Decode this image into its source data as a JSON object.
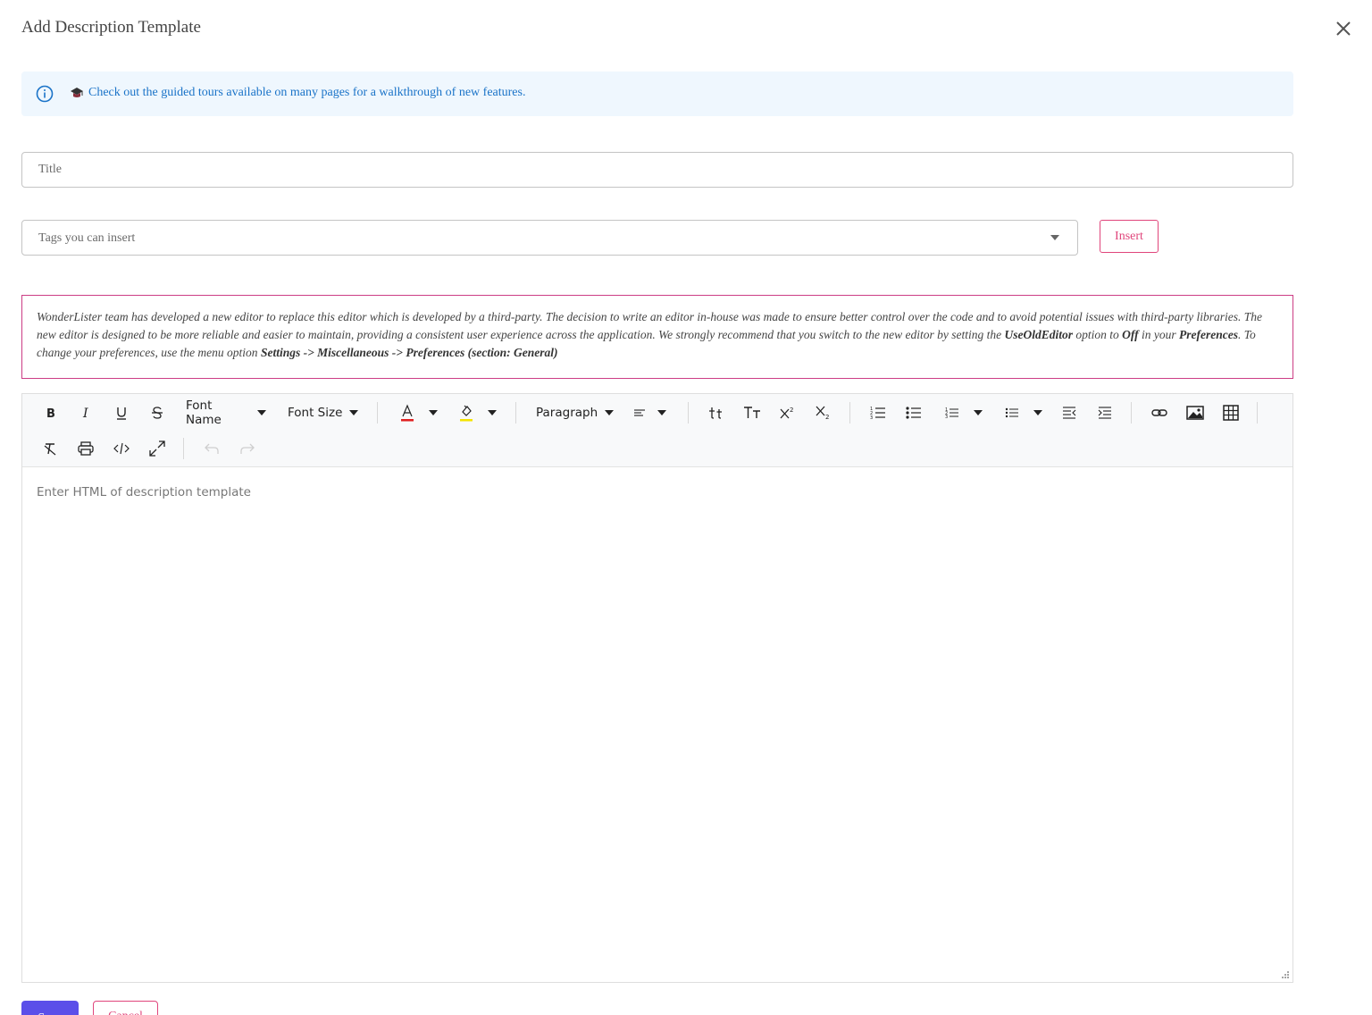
{
  "dialog": {
    "title": "Add Description Template",
    "close_icon": "close-icon"
  },
  "info_banner": {
    "icon": "info-icon",
    "prefix_icon": "graduation-cap-icon",
    "text": "Check out the guided tours available on many pages for a walkthrough of new features."
  },
  "form": {
    "title_placeholder": "Title",
    "title_value": "",
    "tags_placeholder": "Tags you can insert",
    "insert_label": "Insert"
  },
  "notice": {
    "part1": "WonderLister team has developed a new editor to replace this editor which is developed by a third-party. The decision to write an editor in-house was made to ensure better control over the code and to avoid potential issues with third-party libraries. The new editor is designed to be more reliable and easier to maintain, providing a consistent user experience across the application. We strongly recommend that you switch to the new editor by setting the ",
    "option_name": "UseOldEditor",
    "part2": " option to ",
    "option_value": "Off",
    "part3": " in your ",
    "preferences": "Preferences",
    "part4": ". To change your preferences, use the menu option ",
    "menu_path": "Settings -> Miscellaneous -> Preferences (section: General)"
  },
  "toolbar": {
    "font_name": "Font Name",
    "font_size": "Font Size",
    "paragraph": "Paragraph",
    "font_color": "#e02020",
    "highlight_color": "#f5e400",
    "icons": [
      "bold-icon",
      "italic-icon",
      "underline-icon",
      "strikethrough-icon",
      "font-color-icon",
      "highlight-icon",
      "align-icon",
      "lowercase-icon",
      "uppercase-icon",
      "superscript-icon",
      "subscript-icon",
      "ordered-list-icon",
      "unordered-list-icon",
      "numbered-list-format-icon",
      "bulleted-list-format-icon",
      "outdent-icon",
      "indent-icon",
      "link-icon",
      "image-icon",
      "table-icon",
      "clear-format-icon",
      "print-icon",
      "source-code-icon",
      "fullscreen-icon",
      "undo-icon",
      "redo-icon"
    ]
  },
  "editor": {
    "placeholder": "Enter HTML of description template"
  },
  "actions": {
    "save_label": "Save",
    "cancel_label": "Cancel",
    "save_color": "#5b4fe9",
    "accent_color": "#e0457b"
  }
}
